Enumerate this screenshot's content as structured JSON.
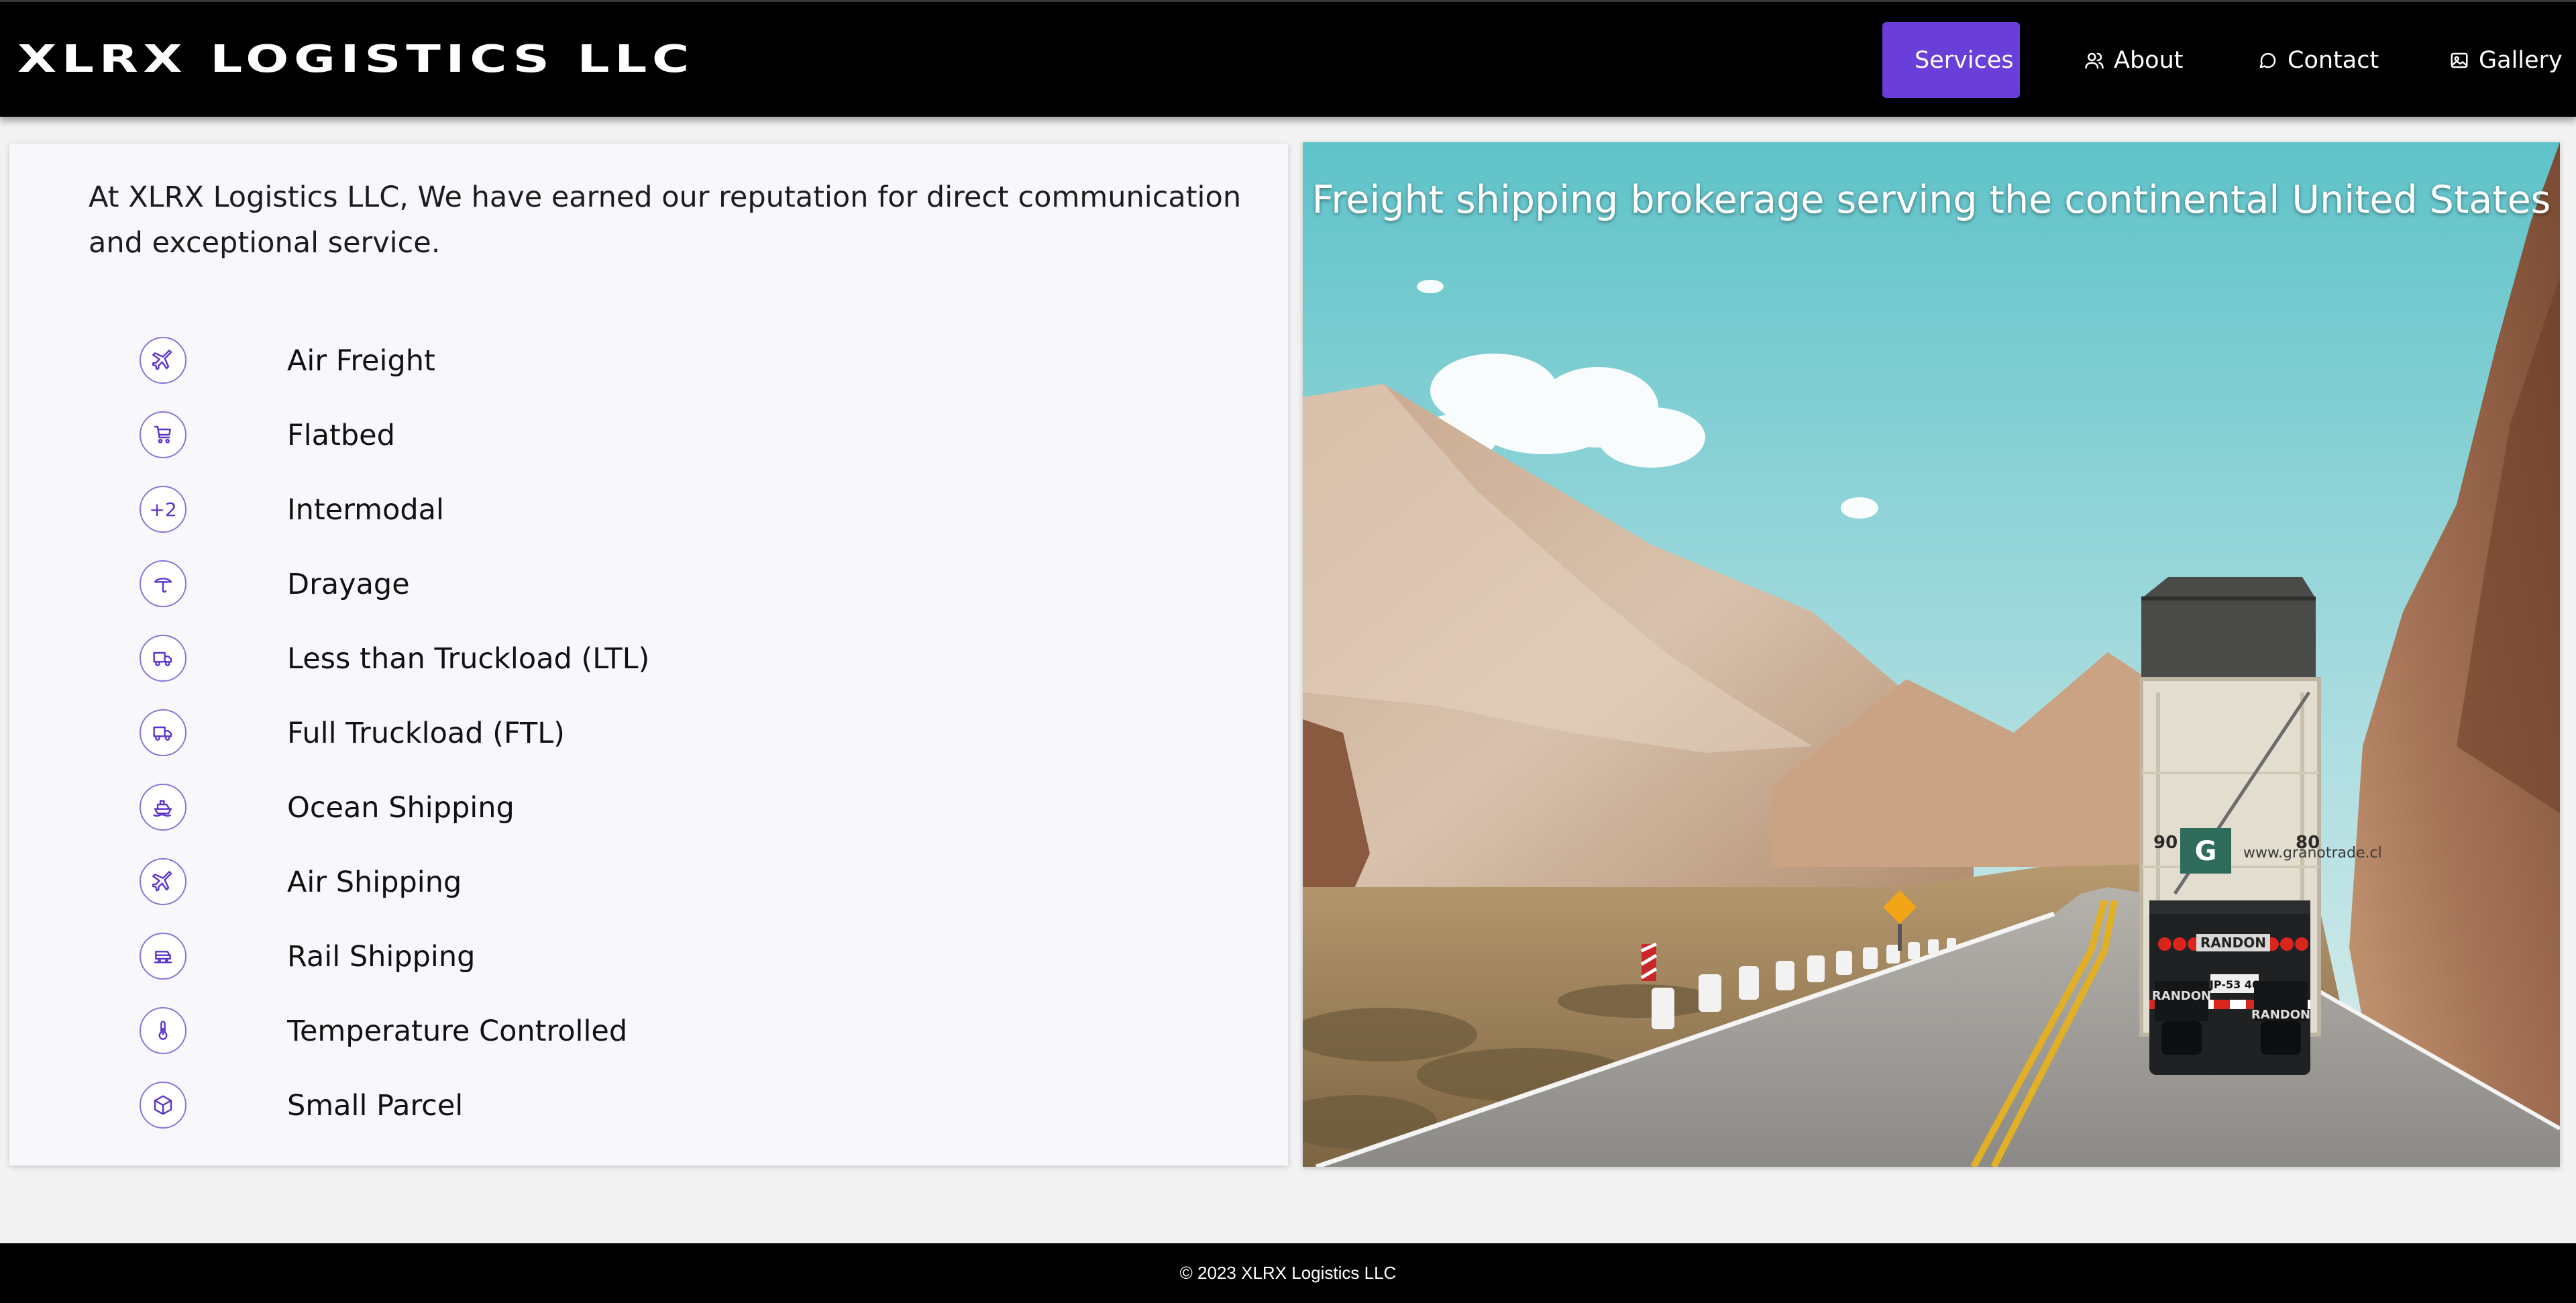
{
  "brand": {
    "name": "XLRX LOGISTICS LLC"
  },
  "nav": {
    "items": [
      {
        "label": "Services",
        "icon": "box-icon",
        "active": true
      },
      {
        "label": "About",
        "icon": "users-icon",
        "active": false
      },
      {
        "label": "Contact",
        "icon": "chat-icon",
        "active": false
      },
      {
        "label": "Gallery",
        "icon": "image-icon",
        "active": false
      }
    ]
  },
  "intro": {
    "text": "At XLRX Logistics LLC, We have earned our reputation for direct communication and exceptional service."
  },
  "services": [
    {
      "label": "Air Freight",
      "icon": "plane-icon"
    },
    {
      "label": "Flatbed",
      "icon": "cart-icon"
    },
    {
      "label": "Intermodal",
      "icon": "plus-two-icon",
      "glyph": "+2"
    },
    {
      "label": "Drayage",
      "icon": "crane-icon"
    },
    {
      "label": "Less than Truckload (LTL)",
      "icon": "truck-icon"
    },
    {
      "label": "Full Truckload (FTL)",
      "icon": "truck-icon"
    },
    {
      "label": "Ocean Shipping",
      "icon": "ship-icon"
    },
    {
      "label": "Air Shipping",
      "icon": "plane-icon"
    },
    {
      "label": "Rail Shipping",
      "icon": "train-icon"
    },
    {
      "label": "Temperature Controlled",
      "icon": "thermometer-icon"
    },
    {
      "label": "Small Parcel",
      "icon": "package-icon"
    }
  ],
  "hero": {
    "caption": "Freight shipping brokerage serving the continental United States",
    "truck_text": {
      "site": "www.granotrade.cl",
      "brand": "RANDON",
      "number_left": "90",
      "number_right": "80",
      "plate": "JP-53 46",
      "logo": "G"
    }
  },
  "footer": {
    "text": "© 2023 XLRX Logistics LLC"
  },
  "colors": {
    "accent": "#6a3ed8",
    "icon": "#5b34c9",
    "nav_bg": "#000000",
    "page_bg": "#f2f2f2",
    "panel_bg": "#f8f8fc"
  }
}
